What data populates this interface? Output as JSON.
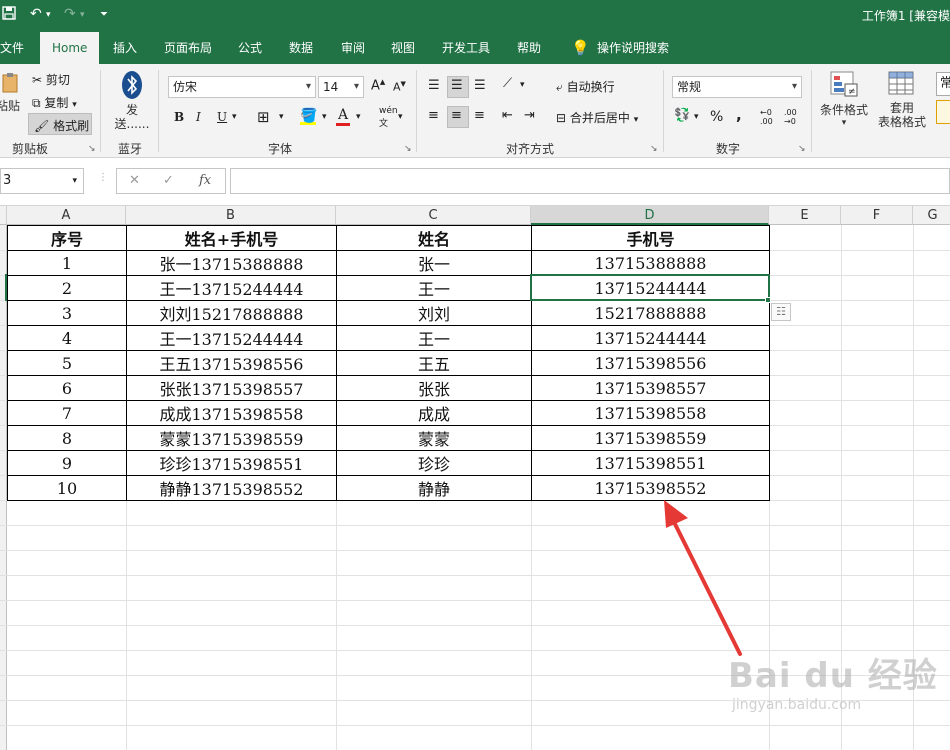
{
  "titlebar": {
    "save_icon": "save-icon",
    "undo_icon": "undo-icon",
    "redo_icon": "redo-icon",
    "customize_icon": "customize-qat-icon",
    "document_title": "工作簿1 [兼容模"
  },
  "tabs": [
    "文件",
    "Home",
    "插入",
    "页面布局",
    "公式",
    "数据",
    "审阅",
    "视图",
    "开发工具",
    "帮助"
  ],
  "tell_me": "操作说明搜索",
  "ribbon": {
    "clipboard": {
      "paste": "粘贴",
      "cut": "剪切",
      "copy": "复制",
      "format_painter": "格式刷",
      "label": "剪贴板"
    },
    "bluetooth": {
      "send": "发送......",
      "label": "蓝牙"
    },
    "font": {
      "name": "仿宋",
      "size": "14",
      "grow": "A",
      "shrink": "A",
      "bold": "B",
      "italic": "I",
      "underline": "U",
      "phonetic": "wén",
      "label": "字体"
    },
    "alignment": {
      "wrap": "自动换行",
      "merge": "合并后居中",
      "label": "对齐方式"
    },
    "number": {
      "format": "常规",
      "percent": "%",
      "comma": ",",
      "label": "数字"
    },
    "styles": {
      "conditional": "条件格式",
      "table_format_1": "套用",
      "table_format_2": "表格格式",
      "cell_styles": "常"
    }
  },
  "formula_bar": {
    "name_box": "3",
    "fx": "fx",
    "cancel": "✕",
    "enter": "✓",
    "formula": ""
  },
  "columns": [
    "A",
    "B",
    "C",
    "D",
    "E",
    "F",
    "G"
  ],
  "selected_column": "D",
  "table": {
    "headers": [
      "序号",
      "姓名+手机号",
      "姓名",
      "手机号"
    ],
    "rows": [
      [
        "1",
        "张一13715388888",
        "张一",
        "13715388888"
      ],
      [
        "2",
        "王一13715244444",
        "王一",
        "13715244444"
      ],
      [
        "3",
        "刘刘15217888888",
        "刘刘",
        "15217888888"
      ],
      [
        "4",
        "王一13715244444",
        "王一",
        "13715244444"
      ],
      [
        "5",
        "王五13715398556",
        "王五",
        "13715398556"
      ],
      [
        "6",
        "张张13715398557",
        "张张",
        "13715398557"
      ],
      [
        "7",
        "成成13715398558",
        "成成",
        "13715398558"
      ],
      [
        "8",
        "蒙蒙13715398559",
        "蒙蒙",
        "13715398559"
      ],
      [
        "9",
        "珍珍13715398551",
        "珍珍",
        "13715398551"
      ],
      [
        "10",
        "静静13715398552",
        "静静",
        "13715398552"
      ]
    ]
  },
  "colors": {
    "excel_green": "#217346",
    "arrow_red": "#e53935"
  },
  "watermark": {
    "brand": "Bai du 经验",
    "url": "jingyan.baidu.com"
  }
}
